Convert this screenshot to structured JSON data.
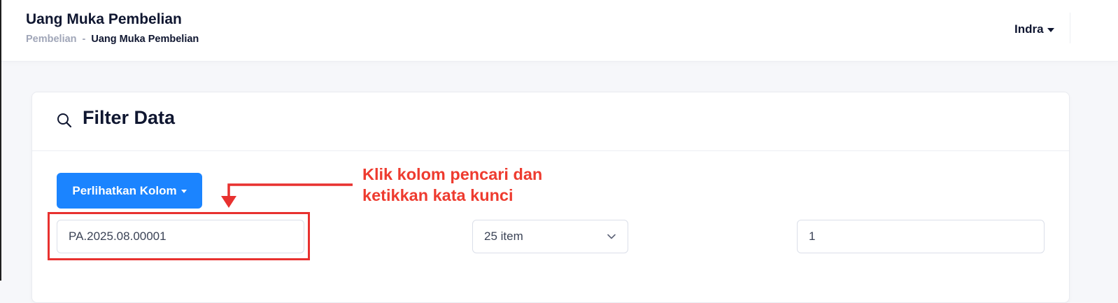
{
  "header": {
    "title": "Uang Muka Pembelian",
    "breadcrumb": {
      "parent": "Pembelian",
      "separator": "-",
      "current": "Uang Muka Pembelian"
    },
    "user": {
      "name": "Indra"
    }
  },
  "filter_card": {
    "title": "Filter Data",
    "icon": "search-icon",
    "show_columns_label": "Perlihatkan Kolom",
    "search_value": "PA.2025.08.00001",
    "per_page_value": "25 item",
    "page_value": "1"
  },
  "annotation": {
    "line1": "Klik kolom pencari dan",
    "line2": "ketikkan kata kunci",
    "color": "#ee3b2f"
  },
  "colors": {
    "primary": "#1b84ff",
    "annotation": "#e8312f"
  }
}
